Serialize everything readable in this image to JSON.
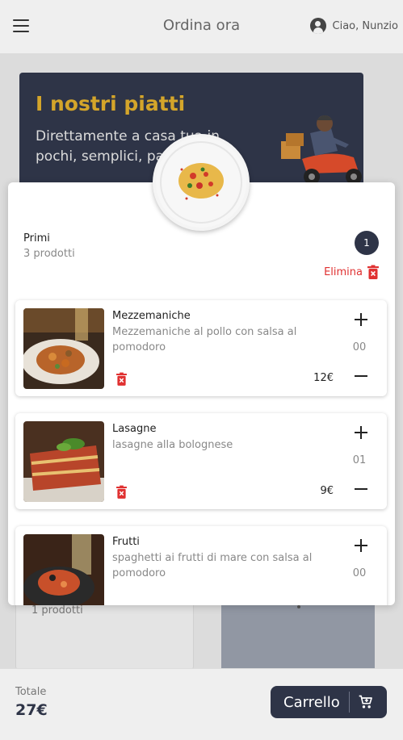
{
  "header": {
    "title": "Ordina ora",
    "user_greeting": "Ciao, Nunzio",
    "menu_icon": "menu-icon",
    "user_icon": "account-circle-icon"
  },
  "hero": {
    "title": "I nostri piatti",
    "subtitle": "Direttamente a casa tua in pochi, semplici, passi"
  },
  "background_card": {
    "count": "1 prodotti"
  },
  "footer": {
    "total_label": "Totale",
    "total_value": "27€",
    "cart_label": "Carrello",
    "cart_icon": "shopping-cart-icon"
  },
  "colors": {
    "brand_dark": "#2e3447",
    "accent_gold": "#d4a52a",
    "danger": "#e03131"
  },
  "modal": {
    "category_name": "Primi",
    "category_count": "3 prodotti",
    "badge": "1",
    "delete_label": "Elimina",
    "delete_icon": "trash-x-icon",
    "items": [
      {
        "name": "Mezzemaniche",
        "description": "Mezzemaniche al pollo con salsa al pomodoro",
        "price": "12€",
        "quantity": "00"
      },
      {
        "name": "Lasagne",
        "description": "lasagne alla bolognese",
        "price": "9€",
        "quantity": "01"
      },
      {
        "name": "Frutti",
        "description": "spaghetti ai frutti di mare con salsa al pomodoro",
        "price": "",
        "quantity": "00"
      }
    ]
  }
}
